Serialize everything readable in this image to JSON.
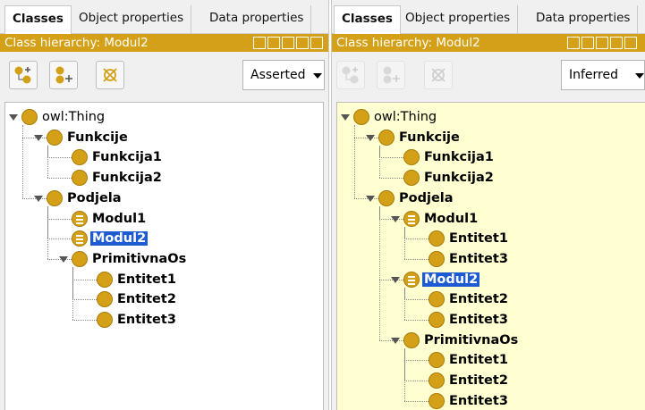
{
  "colors": {
    "title_bar": "#d4a017",
    "selection": "#1e5bd3",
    "inferred_bg": "#ffffd2",
    "class_icon": "#d4a017"
  },
  "left": {
    "tabs": [
      "Classes",
      "Object properties",
      "Data properties"
    ],
    "title": "Class hierarchy: Modul2",
    "dropdown": "Asserted",
    "tree": [
      {
        "label": "owl:Thing",
        "level": 0,
        "expanded": true,
        "icon": "class-icon"
      },
      {
        "label": "Funkcije",
        "level": 1,
        "expanded": true,
        "icon": "class-icon"
      },
      {
        "label": "Funkcija1",
        "level": 2,
        "icon": "class-icon"
      },
      {
        "label": "Funkcija2",
        "level": 2,
        "icon": "class-icon"
      },
      {
        "label": "Podjela",
        "level": 1,
        "expanded": true,
        "icon": "class-icon"
      },
      {
        "label": "Modul1",
        "level": 2,
        "icon": "defined-class-icon"
      },
      {
        "label": "Modul2",
        "level": 2,
        "icon": "defined-class-icon",
        "selected": true
      },
      {
        "label": "PrimitivnaOs",
        "level": 2,
        "expanded": true,
        "icon": "class-icon"
      },
      {
        "label": "Entitet1",
        "level": 3,
        "icon": "class-icon"
      },
      {
        "label": "Entitet2",
        "level": 3,
        "icon": "class-icon"
      },
      {
        "label": "Entitet3",
        "level": 3,
        "icon": "class-icon"
      }
    ]
  },
  "right": {
    "tabs": [
      "Classes",
      "Object properties",
      "Data properties"
    ],
    "title": "Class hierarchy: Modul2",
    "dropdown": "Inferred",
    "tree": [
      {
        "label": "owl:Thing",
        "level": 0,
        "expanded": true,
        "icon": "class-icon"
      },
      {
        "label": "Funkcije",
        "level": 1,
        "expanded": true,
        "icon": "class-icon"
      },
      {
        "label": "Funkcija1",
        "level": 2,
        "icon": "class-icon"
      },
      {
        "label": "Funkcija2",
        "level": 2,
        "icon": "class-icon"
      },
      {
        "label": "Podjela",
        "level": 1,
        "expanded": true,
        "icon": "class-icon"
      },
      {
        "label": "Modul1",
        "level": 2,
        "expanded": true,
        "icon": "defined-class-icon"
      },
      {
        "label": "Entitet1",
        "level": 3,
        "icon": "class-icon"
      },
      {
        "label": "Entitet3",
        "level": 3,
        "icon": "class-icon"
      },
      {
        "label": "Modul2",
        "level": 2,
        "expanded": true,
        "icon": "defined-class-icon",
        "selected": true
      },
      {
        "label": "Entitet2",
        "level": 3,
        "icon": "class-icon"
      },
      {
        "label": "Entitet3",
        "level": 3,
        "icon": "class-icon"
      },
      {
        "label": "PrimitivnaOs",
        "level": 2,
        "expanded": true,
        "icon": "class-icon"
      },
      {
        "label": "Entitet1",
        "level": 3,
        "icon": "class-icon"
      },
      {
        "label": "Entitet2",
        "level": 3,
        "icon": "class-icon"
      },
      {
        "label": "Entitet3",
        "level": 3,
        "icon": "class-icon"
      }
    ]
  }
}
